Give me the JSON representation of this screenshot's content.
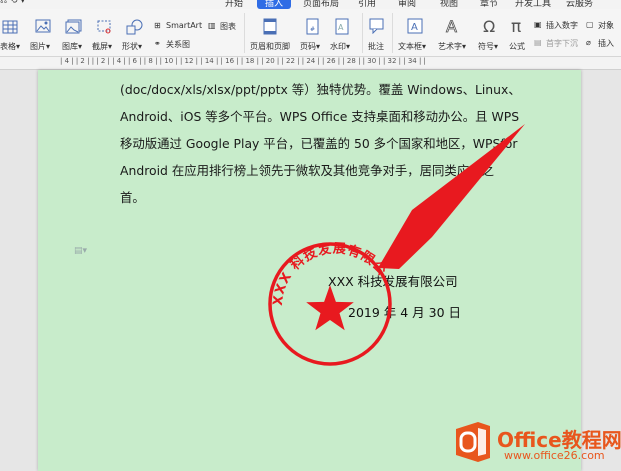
{
  "menu_tabs": [
    {
      "label": "开始",
      "active": false
    },
    {
      "label": "插入",
      "active": true
    },
    {
      "label": "页面布局",
      "active": false
    },
    {
      "label": "引用",
      "active": false
    },
    {
      "label": "审阅",
      "active": false
    },
    {
      "label": "视图",
      "active": false
    },
    {
      "label": "章节",
      "active": false
    },
    {
      "label": "开发工具",
      "active": false
    },
    {
      "label": "云服务",
      "active": false
    }
  ],
  "ribbon": {
    "table": "表格▾",
    "picture": "图片▾",
    "gallery": "图库▾",
    "screenshot": "截屏▾",
    "shapes": "形状▾",
    "smartart": "SmartArt",
    "chart": "图表",
    "relation": "关系图",
    "header_footer": "页眉和页脚",
    "page_number": "页码▾",
    "watermark": "水印▾",
    "comment": "批注",
    "textbox": "文本框▾",
    "wordart": "艺术字▾",
    "symbol": "符号▾",
    "formula": "公式",
    "insert_number": "插入数字",
    "first_drop": "首字下沉",
    "object": "对象",
    "insert": "插入"
  },
  "ruler_text": "| 4 | | 2 | | | 2 | | 4 | | 6 | | 8 | | 10 | | 12 | | 14 | | 16 | | 18 | | 20 | | 22 | | 24 | | 26 | | 28 | | 30 | | 32 | | 34 | |",
  "document": {
    "lines": [
      "(doc/docx/xls/xlsx/ppt/pptx 等）独特优势。覆盖 Windows、Linux、",
      "Android、iOS 等多个平台。WPS Office 支持桌面和移动办公。且 WPS",
      "移动版通过 Google Play 平台，已覆盖的 50 多个国家和地区，WPSfor",
      "Android 在应用排行榜上领先于微软及其他竞争对手，居同类应用之",
      "首。"
    ],
    "company": "XXX 科技发展有限公司",
    "date": "2019 年 4 月 30 日"
  },
  "seal": {
    "text": "XXX 科技发展有限公司",
    "color": "#e8191f"
  },
  "arrow_color": "#e8191f",
  "logo": {
    "main": "Office教程网",
    "sub": "www.office26.com",
    "color": "#e8561d"
  }
}
